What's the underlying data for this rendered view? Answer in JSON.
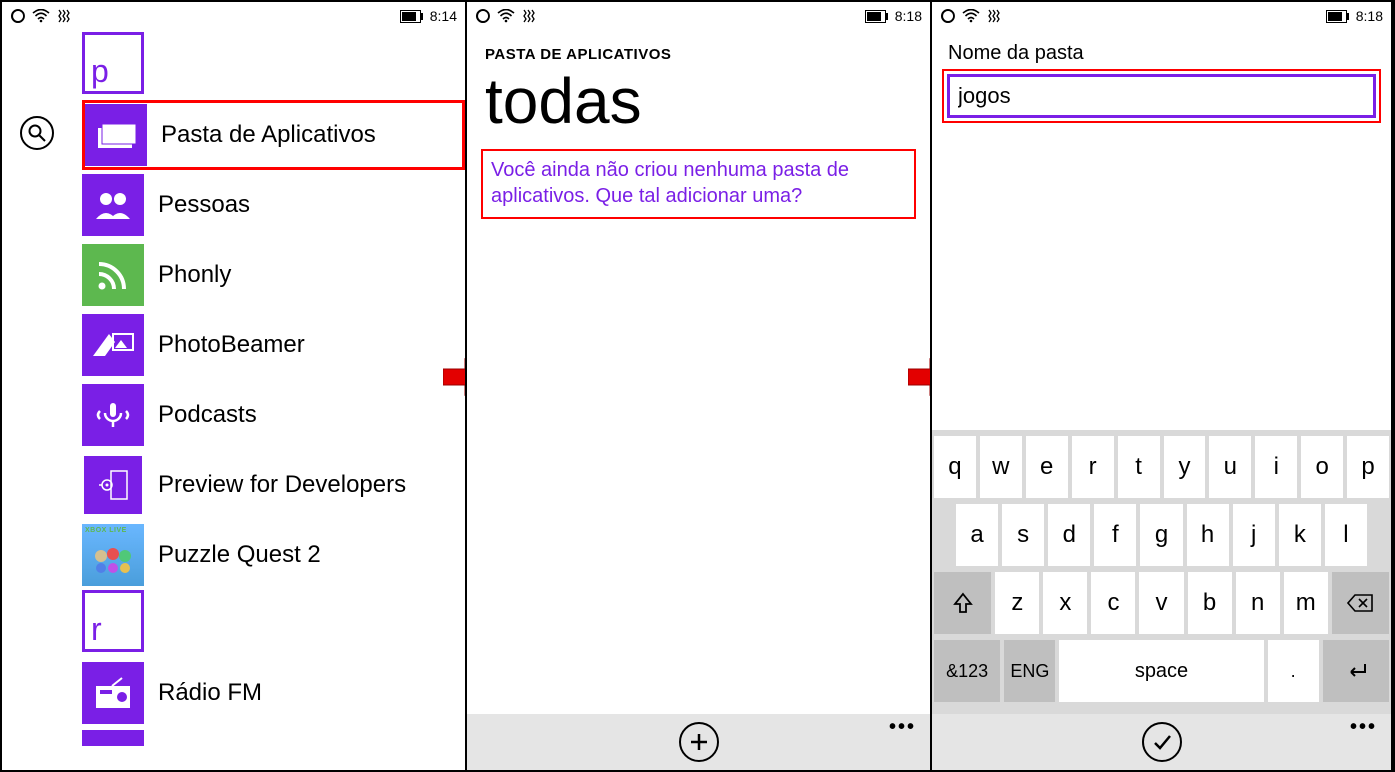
{
  "accent": "#7A1FE6",
  "highlight": "#FF0000",
  "panel1": {
    "statusbar": {
      "time": "8:14"
    },
    "letter_p": "p",
    "letter_r": "r",
    "apps": [
      {
        "label": "Pasta de Aplicativos",
        "icon": "folder"
      },
      {
        "label": "Pessoas",
        "icon": "people"
      },
      {
        "label": "Phonly",
        "icon": "rss"
      },
      {
        "label": "PhotoBeamer",
        "icon": "photobeamer"
      },
      {
        "label": "Podcasts",
        "icon": "podcast"
      },
      {
        "label": "Preview for Developers",
        "icon": "pfd"
      },
      {
        "label": "Puzzle Quest 2",
        "icon": "pq"
      }
    ],
    "apps_r": [
      {
        "label": "Rádio FM",
        "icon": "radio"
      }
    ]
  },
  "panel2": {
    "statusbar": {
      "time": "8:18"
    },
    "header": "PASTA DE APLICATIVOS",
    "title": "todas",
    "message": "Você ainda não criou nenhuma pasta de aplicativos. Que tal adicionar uma?"
  },
  "panel3": {
    "statusbar": {
      "time": "8:18"
    },
    "field_label": "Nome da pasta",
    "field_value": "jogos",
    "keyboard": {
      "row1": [
        "q",
        "w",
        "e",
        "r",
        "t",
        "y",
        "u",
        "i",
        "o",
        "p"
      ],
      "row2": [
        "a",
        "s",
        "d",
        "f",
        "g",
        "h",
        "j",
        "k",
        "l"
      ],
      "row3_shift": "↑",
      "row3": [
        "z",
        "x",
        "c",
        "v",
        "b",
        "n",
        "m"
      ],
      "row3_back": "⌫",
      "row4_sym": "&123",
      "row4_lang": "ENG",
      "row4_space": "space",
      "row4_dot": ".",
      "row4_enter": "↵"
    }
  }
}
